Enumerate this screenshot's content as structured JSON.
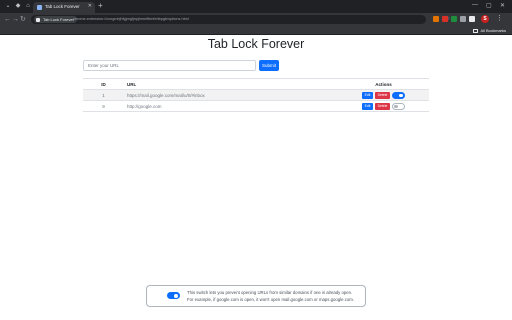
{
  "browser": {
    "tab_title": "Tab Lock Forever",
    "address_chip": "Tab Lock Forever",
    "address_url": "chrome-extension://ccngmbjhfgjmgfjnpjhmnlfbmfehbpgb/options.html",
    "profile_initial": "S",
    "bookmarks_label": "All Bookmarks",
    "extension_icon_colors": [
      "#e37400",
      "#d93025",
      "#1e8e3e",
      "#9aa0a6",
      "#e8eaed"
    ]
  },
  "page": {
    "title": "Tab Lock Forever",
    "url_placeholder": "Enter your URL",
    "submit_label": "Submit"
  },
  "table": {
    "headers": {
      "id": "ID",
      "url": "URL",
      "actions": "Actions"
    },
    "rows": [
      {
        "id": "1",
        "url": "https://mail.google.com/mail/u/0/#inbox",
        "edit": "Edit",
        "delete": "Delete",
        "lock_on": true
      },
      {
        "id": "9",
        "url": "http://google.com",
        "edit": "Edit",
        "delete": "Delete",
        "lock_on": false
      }
    ]
  },
  "info": {
    "switch_on": true,
    "line1": "This switch lets you prevent opening URLs from similar domains if one is already open.",
    "line2": "For example, if google.com is open, it won't open mail.google.com or maps.google.com."
  },
  "colors": {
    "primary": "#0d6efd",
    "danger": "#dc3545",
    "chrome_dark": "#202124",
    "chrome_toolbar": "#35363a"
  }
}
